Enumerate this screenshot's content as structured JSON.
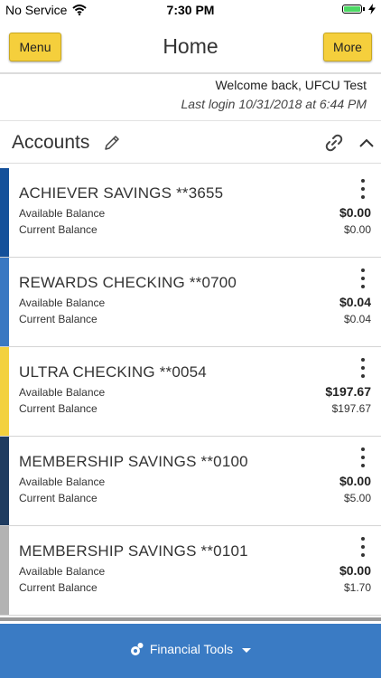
{
  "status_bar": {
    "carrier": "No Service",
    "time": "7:30 PM"
  },
  "nav": {
    "menu_label": "Menu",
    "title": "Home",
    "more_label": "More"
  },
  "welcome": {
    "greeting": "Welcome back, UFCU Test",
    "last_login": "Last login 10/31/2018 at 6:44 PM"
  },
  "accounts_section": {
    "title": "Accounts"
  },
  "accounts": [
    {
      "name": "ACHIEVER SAVINGS **3655",
      "available_label": "Available Balance",
      "available": "$0.00",
      "current_label": "Current Balance",
      "current": "$0.00",
      "color": "#14509a"
    },
    {
      "name": "REWARDS CHECKING **0700",
      "available_label": "Available Balance",
      "available": "$0.04",
      "current_label": "Current Balance",
      "current": "$0.04",
      "color": "#3a78c2"
    },
    {
      "name": "ULTRA CHECKING **0054",
      "available_label": "Available Balance",
      "available": "$197.67",
      "current_label": "Current Balance",
      "current": "$197.67",
      "color": "#f3d13e"
    },
    {
      "name": "MEMBERSHIP SAVINGS **0100",
      "available_label": "Available Balance",
      "available": "$0.00",
      "current_label": "Current Balance",
      "current": "$5.00",
      "color": "#1f3c60"
    },
    {
      "name": "MEMBERSHIP SAVINGS **0101",
      "available_label": "Available Balance",
      "available": "$0.00",
      "current_label": "Current Balance",
      "current": "$1.70",
      "color": "#b3b3b3"
    }
  ],
  "bottom_bar": {
    "label": "Financial Tools"
  },
  "colors": {
    "button_yellow": "#f5cf3c",
    "bottom_bar_blue": "#3a7bc4"
  },
  "icons": [
    "wifi-icon",
    "battery-icon",
    "charging-icon",
    "pencil-icon",
    "link-icon",
    "chevron-up-icon",
    "more-vertical-icon",
    "financial-tools-icon",
    "caret-down-icon"
  ]
}
